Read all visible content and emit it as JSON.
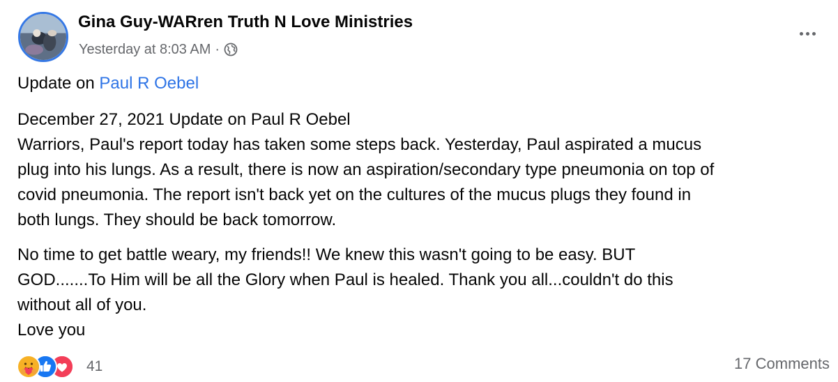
{
  "post": {
    "author": "Gina Guy-WARren Truth N Love Ministries",
    "timestamp": "Yesterday at 8:03 AM",
    "separator": "·",
    "privacy_icon": "globe-icon",
    "more_icon": "more-options-icon",
    "intro_prefix": "Update on ",
    "intro_mention": "Paul R Oebel",
    "paragraph2_lines": [
      "December 27, 2021 Update on Paul R Oebel",
      "Warriors, Paul's report today has taken some steps back. Yesterday, Paul aspirated a mucus",
      "plug into his lungs. As a result, there is now an aspiration/secondary type pneumonia on top of",
      "covid pneumonia. The report isn't back yet on the cultures of the mucus plugs they found in",
      "both lungs. They should be back tomorrow."
    ],
    "paragraph3_lines": [
      "No time to get battle weary, my friends!! We knew this wasn't going to be easy. BUT",
      "GOD.......To Him will be all the Glory when Paul is healed.  Thank you all...couldn't do this",
      "without all of you.",
      "Love you"
    ]
  },
  "footer": {
    "reaction_icons": [
      "care-reaction-icon",
      "like-reaction-icon",
      "love-reaction-icon"
    ],
    "reaction_count": "41",
    "comments": "17 Comments"
  },
  "colors": {
    "link": "#2e74e6",
    "secondary_text": "#65676b",
    "like_blue": "#1877f2",
    "love_red": "#f33e58",
    "care_yellow": "#f7b125"
  }
}
